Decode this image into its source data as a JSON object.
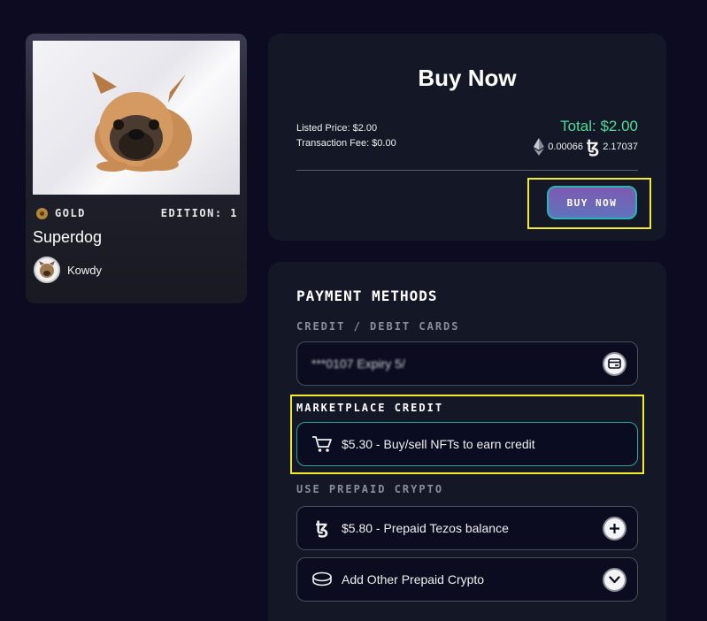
{
  "nft": {
    "rarity": "GOLD",
    "edition": "EDITION: 1",
    "title": "Superdog",
    "owner": "Kowdy"
  },
  "buy": {
    "title": "Buy Now",
    "listed_price": "Listed Price: $2.00",
    "transaction_fee": "Transaction Fee: $0.00",
    "total": "Total: $2.00",
    "eth_amount": "0.00066",
    "tez_amount": "2.17037",
    "button_label": "BUY NOW"
  },
  "payment": {
    "title": "PAYMENT METHODS",
    "cards_label": "CREDIT / DEBIT CARDS",
    "card_masked": "***0107 Expiry 5/",
    "marketplace_label": "MARKETPLACE CREDIT",
    "marketplace_credit": "$5.30 - Buy/sell NFTs to earn credit",
    "prepaid_label": "USE PREPAID CRYPTO",
    "tezos_balance": "$5.80 - Prepaid Tezos balance",
    "add_other": "Add Other Prepaid Crypto"
  },
  "colors": {
    "background": "#0c0b22",
    "panel": "#141726",
    "total_green": "#4ddc9a",
    "highlight_yellow": "#f2ea2a",
    "credit_border": "#2aa59b"
  }
}
